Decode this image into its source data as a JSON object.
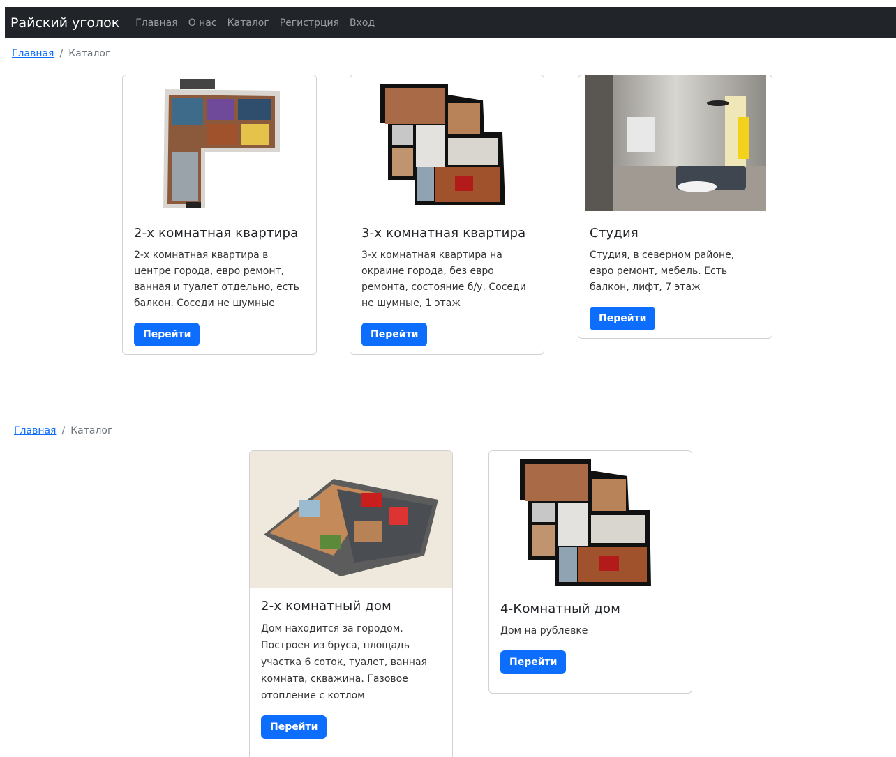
{
  "navbar": {
    "brand": "Райский уголок",
    "links": [
      "Главная",
      "О нас",
      "Каталог",
      "Регистрция",
      "Вход"
    ]
  },
  "breadcrumbs": [
    {
      "home": "Главная",
      "current": "Каталог"
    },
    {
      "home": "Главная",
      "current": "Каталог"
    }
  ],
  "cards": [
    {
      "title": "2-х комнатная квартира",
      "text": "2-х комнатная квартира в центре города, евро ремонт, ванная и туалет отдельно, есть балкон. Соседи не шумные",
      "button": "Перейти"
    },
    {
      "title": "3-х комнатная квартира",
      "text": "3-х комнатная квартира на окраине города, без евро ремонта, состояние б/у. Соседи не шумные, 1 этаж",
      "button": "Перейти"
    },
    {
      "title": "Студия",
      "text": "Студия, в северном районе, евро ремонт, мебель. Есть балкон, лифт, 7 этаж",
      "button": "Перейти"
    },
    {
      "title": "2-х комнатный дом",
      "text": "Дом находится за городом. Построен из бруса, площадь участка 6 соток, туалет, ванная комната, скважина. Газовое отопление с котлом",
      "button": "Перейти"
    },
    {
      "title": "4-Комнатный дом",
      "text": "Дом на рублевке",
      "button": "Перейти"
    }
  ],
  "colors": {
    "navbar": "#212529",
    "primary": "#0d6efd"
  }
}
